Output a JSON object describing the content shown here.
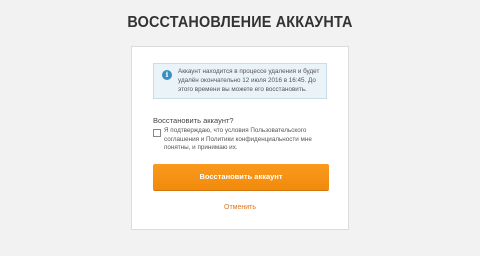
{
  "page": {
    "title": "ВОССТАНОВЛЕНИЕ АККАУНТА"
  },
  "notice": {
    "icon": "info-icon",
    "icon_glyph": "i",
    "text": "Аккаунт находится в процессе удаления и будет удалён окончательно 12 июля 2016 в 16:45. До этого времени вы можете его восстановить."
  },
  "form": {
    "question": "Восстановить аккаунт?",
    "consent": {
      "checked": false,
      "text": "Я подтверждаю, что условия Пользовательского соглашения и Политики конфиденциальности мне понятны, и принимаю их."
    },
    "restore_label": "Восстановить аккаунт",
    "cancel_label": "Отменить"
  },
  "colors": {
    "accent": "#f7941d",
    "link": "#e0761a",
    "info": "#3b8ec2",
    "notice_bg": "#eaf3f8"
  }
}
